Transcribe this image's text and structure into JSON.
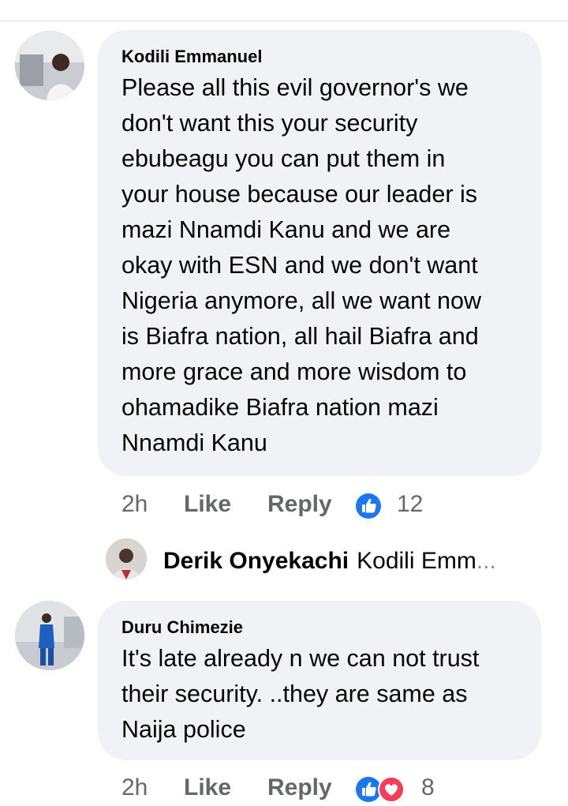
{
  "comments": [
    {
      "author": "Kodili Emmanuel",
      "lines": [
        "Please all this evil governor's we",
        "don't want this your security",
        "ebubeagu you can put them in",
        "your house because our leader is",
        "mazi Nnamdi Kanu and we are",
        "okay with ESN and we don't want",
        "Nigeria anymore, all we want now",
        "is Biafra nation, all hail Biafra and",
        "more grace and more wisdom to",
        "ohamadike Biafra nation mazi",
        "Nnamdi Kanu"
      ],
      "time": "2h",
      "like_label": "Like",
      "reply_label": "Reply",
      "reaction_count": "12",
      "reactions": [
        "like-icon"
      ]
    },
    {
      "author": "Duru Chimezie",
      "lines": [
        "It's late already n we can not trust",
        "their security. ..they are same as",
        "Naija police"
      ],
      "time": "2h",
      "like_label": "Like",
      "reply_label": "Reply",
      "reaction_count": "8",
      "reactions": [
        "like-icon",
        "love-icon"
      ]
    }
  ],
  "reply_preview": {
    "author": "Derik Onyekachi",
    "text": "Kodili Emm",
    "ellipsis": "..."
  },
  "colors": {
    "bubble": "#f0f2f5",
    "muted_text": "#65676b",
    "like_blue": "#1877f2",
    "love_red": "#f33e58"
  }
}
